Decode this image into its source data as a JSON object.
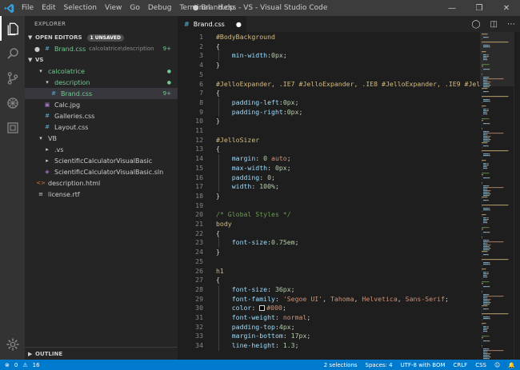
{
  "window": {
    "title": "● Brand.css - VS - Visual Studio Code",
    "menu": [
      "File",
      "Edit",
      "Selection",
      "View",
      "Go",
      "Debug",
      "Terminal",
      "Help"
    ]
  },
  "sidebar": {
    "title": "EXPLORER",
    "open_editors": {
      "label": "OPEN EDITORS",
      "badge": "1 UNSAVED",
      "item": {
        "name": "Brand.css",
        "path": "calcolatrice\\description",
        "count": "9+"
      }
    },
    "workspace": "VS",
    "tree": [
      {
        "label": "calcolatrice",
        "icon": "chevron-down-icon",
        "status": "●",
        "level": 1,
        "color": "green"
      },
      {
        "label": "description",
        "icon": "chevron-down-icon",
        "status": "●",
        "level": 2,
        "color": "green"
      },
      {
        "label": "Brand.css",
        "icon": "css-file-icon",
        "status": "9+",
        "level": 3,
        "color": "green",
        "selected": true
      },
      {
        "label": "Calc.jpg",
        "icon": "image-file-icon",
        "status": "",
        "level": 2,
        "color": "normal"
      },
      {
        "label": "Galleries.css",
        "icon": "css-file-icon",
        "status": "",
        "level": 2,
        "color": "normal"
      },
      {
        "label": "Layout.css",
        "icon": "css-file-icon",
        "status": "",
        "level": 2,
        "color": "normal"
      },
      {
        "label": "VB",
        "icon": "chevron-down-icon",
        "status": "",
        "level": 1,
        "color": "normal"
      },
      {
        "label": ".vs",
        "icon": "chevron-right-icon",
        "status": "",
        "level": 2,
        "color": "normal"
      },
      {
        "label": "ScientificCalculatorVisualBasic",
        "icon": "chevron-right-icon",
        "status": "",
        "level": 2,
        "color": "normal"
      },
      {
        "label": "ScientificCalculatorVisualBasic.sln",
        "icon": "sln-file-icon",
        "status": "",
        "level": 2,
        "color": "normal"
      },
      {
        "label": "description.html",
        "icon": "html-file-icon",
        "status": "",
        "level": 1,
        "color": "normal"
      },
      {
        "label": "license.rtf",
        "icon": "text-file-icon",
        "status": "",
        "level": 1,
        "color": "normal"
      }
    ],
    "outline_label": "OUTLINE"
  },
  "tab": {
    "label": "Brand.css",
    "dirty": "●"
  },
  "code": [
    {
      "n": "1",
      "t": [
        [
          "sel",
          "#BodyBackground"
        ]
      ]
    },
    {
      "n": "2",
      "t": [
        [
          "pun",
          "{"
        ]
      ]
    },
    {
      "n": "3",
      "t": [
        [
          "pun",
          "    "
        ],
        [
          "prop",
          "min-width"
        ],
        [
          "pun",
          ":"
        ],
        [
          "num",
          "0px"
        ],
        [
          "pun",
          ";"
        ]
      ]
    },
    {
      "n": "4",
      "t": [
        [
          "pun",
          "}"
        ]
      ]
    },
    {
      "n": "5",
      "t": []
    },
    {
      "n": "6",
      "t": [
        [
          "sel",
          "#JelloExpander, .IE7 #JelloExpander, .IE8 #JelloExpander, .IE9 #Jel"
        ]
      ]
    },
    {
      "n": "7",
      "t": [
        [
          "pun",
          "{"
        ]
      ]
    },
    {
      "n": "8",
      "t": [
        [
          "pun",
          "    "
        ],
        [
          "prop",
          "padding-left"
        ],
        [
          "pun",
          ":"
        ],
        [
          "num",
          "0px"
        ],
        [
          "pun",
          ";"
        ]
      ]
    },
    {
      "n": "9",
      "t": [
        [
          "pun",
          "    "
        ],
        [
          "prop",
          "padding-right"
        ],
        [
          "pun",
          ":"
        ],
        [
          "num",
          "0px"
        ],
        [
          "pun",
          ";"
        ]
      ]
    },
    {
      "n": "10",
      "t": [
        [
          "pun",
          "}"
        ]
      ]
    },
    {
      "n": "11",
      "t": []
    },
    {
      "n": "12",
      "t": [
        [
          "sel",
          "#JelloSizer"
        ]
      ]
    },
    {
      "n": "13",
      "t": [
        [
          "pun",
          "{"
        ]
      ]
    },
    {
      "n": "14",
      "t": [
        [
          "pun",
          "    "
        ],
        [
          "prop",
          "margin"
        ],
        [
          "pun",
          ": "
        ],
        [
          "num",
          "0"
        ],
        [
          "str",
          " auto"
        ],
        [
          "pun",
          ";"
        ]
      ]
    },
    {
      "n": "15",
      "t": [
        [
          "pun",
          "    "
        ],
        [
          "prop",
          "max-width"
        ],
        [
          "pun",
          ": "
        ],
        [
          "num",
          "0px"
        ],
        [
          "pun",
          ";"
        ]
      ]
    },
    {
      "n": "16",
      "t": [
        [
          "pun",
          "    "
        ],
        [
          "prop",
          "padding"
        ],
        [
          "pun",
          ": "
        ],
        [
          "num",
          "0"
        ],
        [
          "pun",
          ";"
        ]
      ]
    },
    {
      "n": "17",
      "t": [
        [
          "pun",
          "    "
        ],
        [
          "prop",
          "width"
        ],
        [
          "pun",
          ": "
        ],
        [
          "num",
          "100%"
        ],
        [
          "pun",
          ";"
        ]
      ]
    },
    {
      "n": "18",
      "t": [
        [
          "pun",
          "}"
        ]
      ]
    },
    {
      "n": "19",
      "t": []
    },
    {
      "n": "20",
      "t": [
        [
          "cmt",
          "/* Global Styles */"
        ]
      ]
    },
    {
      "n": "21",
      "t": [
        [
          "sel",
          "body"
        ]
      ]
    },
    {
      "n": "22",
      "t": [
        [
          "pun",
          "{"
        ]
      ]
    },
    {
      "n": "23",
      "t": [
        [
          "pun",
          "    "
        ],
        [
          "prop",
          "font-size"
        ],
        [
          "pun",
          ":"
        ],
        [
          "num",
          "0.75em"
        ],
        [
          "pun",
          ";"
        ]
      ]
    },
    {
      "n": "24",
      "t": [
        [
          "pun",
          "}"
        ]
      ]
    },
    {
      "n": "25",
      "t": []
    },
    {
      "n": "26",
      "t": [
        [
          "sel",
          "h1"
        ]
      ]
    },
    {
      "n": "27",
      "t": [
        [
          "pun",
          "{"
        ]
      ]
    },
    {
      "n": "28",
      "t": [
        [
          "pun",
          "    "
        ],
        [
          "prop",
          "font-size"
        ],
        [
          "pun",
          ": "
        ],
        [
          "num",
          "36px"
        ],
        [
          "pun",
          ";"
        ]
      ]
    },
    {
      "n": "29",
      "t": [
        [
          "pun",
          "    "
        ],
        [
          "prop",
          "font-family"
        ],
        [
          "pun",
          ": "
        ],
        [
          "str",
          "'Segoe UI'"
        ],
        [
          "pun",
          ", "
        ],
        [
          "str",
          "Tahoma"
        ],
        [
          "pun",
          ", "
        ],
        [
          "str",
          "Helvetica"
        ],
        [
          "pun",
          ", "
        ],
        [
          "str",
          "Sans-Serif"
        ],
        [
          "pun",
          ";"
        ]
      ]
    },
    {
      "n": "30",
      "t": [
        [
          "pun",
          "    "
        ],
        [
          "prop",
          "color"
        ],
        [
          "pun",
          ": "
        ],
        [
          "swatch",
          ""
        ],
        [
          "str",
          "#000"
        ],
        [
          "pun",
          ";"
        ]
      ]
    },
    {
      "n": "31",
      "t": [
        [
          "pun",
          "    "
        ],
        [
          "prop",
          "font-weight"
        ],
        [
          "pun",
          ": "
        ],
        [
          "str",
          "normal"
        ],
        [
          "pun",
          ";"
        ]
      ]
    },
    {
      "n": "32",
      "t": [
        [
          "pun",
          "    "
        ],
        [
          "prop",
          "padding-top"
        ],
        [
          "pun",
          ":"
        ],
        [
          "num",
          "4px"
        ],
        [
          "pun",
          ";"
        ]
      ]
    },
    {
      "n": "33",
      "t": [
        [
          "pun",
          "    "
        ],
        [
          "prop",
          "margin-bottom"
        ],
        [
          "pun",
          ": "
        ],
        [
          "num",
          "17px"
        ],
        [
          "pun",
          ";"
        ]
      ]
    },
    {
      "n": "34",
      "t": [
        [
          "pun",
          "    "
        ],
        [
          "prop",
          "line-height"
        ],
        [
          "pun",
          ": "
        ],
        [
          "num",
          "1.3"
        ],
        [
          "pun",
          ";"
        ]
      ]
    }
  ],
  "status": {
    "errors": "0",
    "warnings": "16",
    "selections": "2 selections",
    "spaces": "Spaces: 4",
    "encoding": "UTF-8 with BOM",
    "eol": "CRLF",
    "language": "CSS"
  },
  "colors": {
    "accent": "#007acc",
    "selector": "#d7ba7d",
    "property": "#9cdcfe",
    "number": "#b5cea8",
    "string": "#ce9178",
    "comment": "#6a9955",
    "modified": "#73c991"
  }
}
